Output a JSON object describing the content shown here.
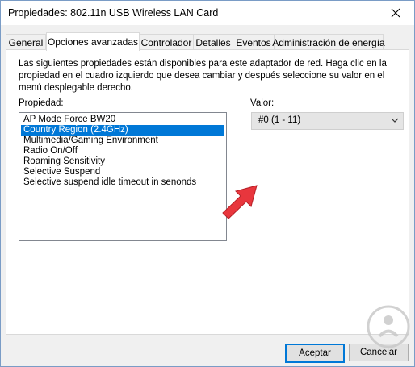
{
  "window": {
    "title": "Propiedades: 802.11n USB Wireless LAN Card"
  },
  "tabs": [
    {
      "label": "General"
    },
    {
      "label": "Opciones avanzadas"
    },
    {
      "label": "Controlador"
    },
    {
      "label": "Detalles"
    },
    {
      "label": "Eventos"
    },
    {
      "label": "Administración de energía"
    }
  ],
  "active_tab_index": 1,
  "panel": {
    "description": "Las siguientes propiedades están disponibles para este adaptador de red. Haga clic en la propiedad en el cuadro izquierdo que desea cambiar y después seleccione su valor en el menú desplegable derecho.",
    "property_label": "Propiedad:",
    "properties": [
      "AP Mode Force BW20",
      "Country Region (2.4GHz)",
      "Multimedia/Gaming Environment",
      "Radio On/Off",
      "Roaming Sensitivity",
      "Selective Suspend",
      "Selective suspend idle timeout in senonds"
    ],
    "selected_property_index": 1,
    "value_label": "Valor:",
    "value_selected": "#0 (1 - 11)"
  },
  "buttons": {
    "ok": "Aceptar",
    "cancel": "Cancelar"
  },
  "colors": {
    "selection": "#0078d7",
    "annotation_arrow": "#e8363d"
  },
  "icons": {
    "close": "close-icon",
    "dropdown": "chevron-down-icon",
    "annotation": "red-arrow-icon",
    "watermark": "watermark-logo"
  }
}
